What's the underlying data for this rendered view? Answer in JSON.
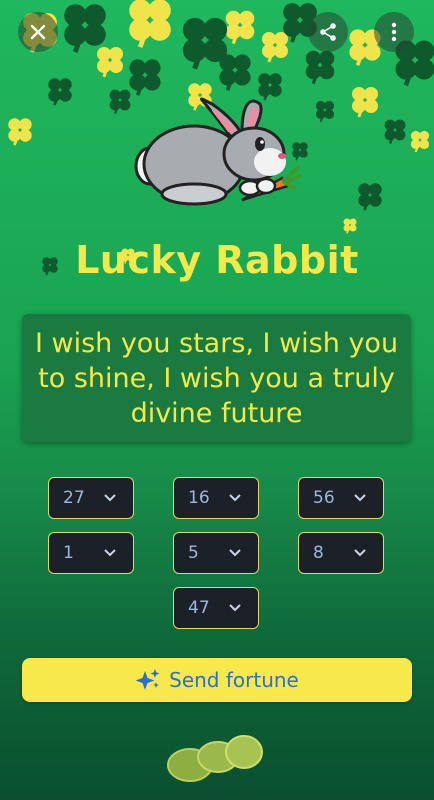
{
  "header": {
    "close_icon": "close-icon",
    "share_icon": "share-icon",
    "menu_icon": "more-vertical-icon"
  },
  "card": {
    "illustration": "rabbit-with-carrot",
    "title": "Lucky Rabbit",
    "wish": "I wish you stars, I wish you to shine, I wish you a truly divine future"
  },
  "numbers": [
    "27",
    "16",
    "56",
    "1",
    "5",
    "8",
    "47"
  ],
  "actions": {
    "send_label": "Send fortune",
    "send_icon": "sparkles-icon"
  },
  "colors": {
    "accent_yellow": "#f5e84a",
    "background_green": "#1fb85e",
    "button_text_blue": "#2b6fd6"
  }
}
